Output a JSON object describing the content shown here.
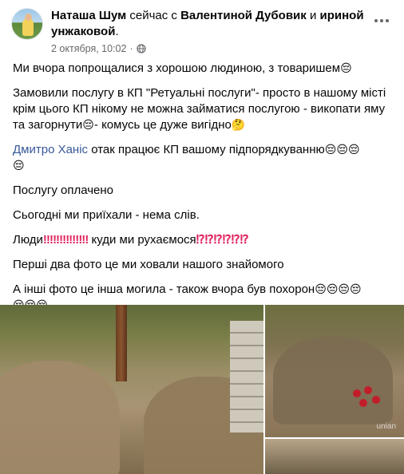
{
  "header": {
    "author": "Наташа Шум",
    "with_text": "сейчас с",
    "tagged_1": "Валентиной Дубовик",
    "and_text": "и",
    "tagged_2": "ириной унжаковой",
    "dot": ".",
    "timestamp": "2 октября, 10:02",
    "separator": "·",
    "privacy_icon": "globe-icon",
    "more_icon": "more-options-icon"
  },
  "post": {
    "p1": "Ми вчора попрощалися з хорошою людиною, з товаришем",
    "p2": "Замовили послугу в КП \"Ретуальні послуги\"- просто в нашому місті крім цього КП нікому не можна займатися послугою - викопати яму та загорнути",
    "p2b": "- комусь це дуже вигідно",
    "p3_mention": "Дмитро Ханіс",
    "p3_text": " отак працює КП вашому підпорядкуванню",
    "p4": "Послугу оплачено",
    "p5": "Сьогодні ми приїхали - нема слів.",
    "p6_a": "Люди",
    "p6_b": " куди ми рухаємося",
    "p7": "Перші два фото це ми ховали нашого знайомого",
    "p8": "А інші фото це інша могила - також вчора був похорон"
  },
  "emoji": {
    "pensive": "😔",
    "thinking": "🤔",
    "bangs": "‼‼‼‼‼‼‼",
    "interrobangs": "⁉⁉⁉⁉⁉⁉"
  },
  "photos": {
    "watermark": "unian"
  }
}
